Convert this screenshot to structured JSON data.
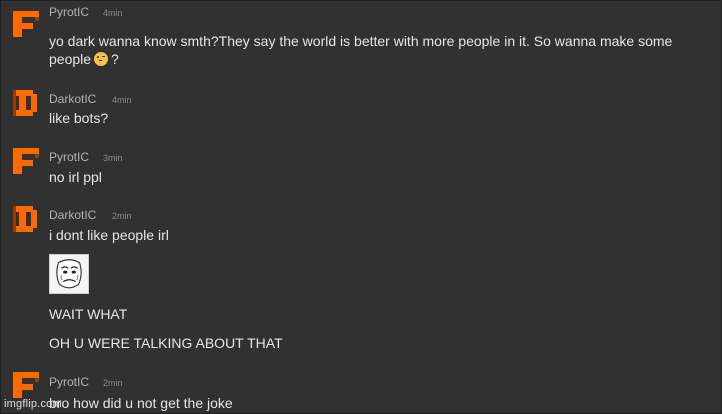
{
  "messages": [
    {
      "user": "PyrotIC",
      "time": "4min",
      "lines": [
        "yo dark wanna know smth?They say the world is better with more people in it. So wanna make some",
        "people",
        "?"
      ]
    },
    {
      "user": "DarkotIC",
      "time": "4min",
      "lines": [
        "like bots?"
      ]
    },
    {
      "user": "PyrotIC",
      "time": "3min",
      "lines": [
        "no irl ppl"
      ]
    },
    {
      "user": "DarkotIC",
      "time": "2min",
      "lines": [
        "i dont like people irl",
        "WAIT WHAT",
        "OH U WERE TALKING ABOUT THAT"
      ]
    },
    {
      "user": "PyrotIC",
      "time": "2min",
      "lines": [
        "bro how did u not get the joke"
      ]
    }
  ],
  "watermark": "imgflip.com",
  "colors": {
    "background": "#313131",
    "avatar_orange": "#ff6a00"
  },
  "icons": {
    "pyrot_avatar": "letter-f-pixel-icon",
    "darkot_avatar": "letter-d-pixel-icon",
    "emoji": "smirk-emoji-icon",
    "image": "rage-face-meme-icon"
  }
}
